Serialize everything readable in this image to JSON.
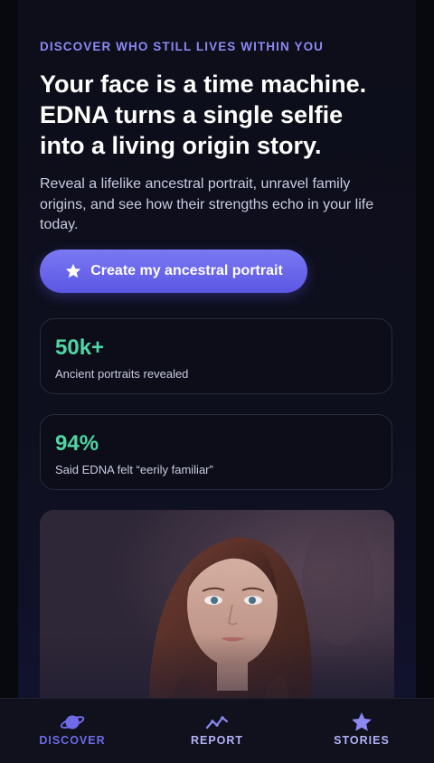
{
  "hero": {
    "eyebrow": "DISCOVER WHO STILL LIVES WITHIN YOU",
    "headline_lines": [
      "Your face is a time machine.",
      "EDNA turns a single selfie",
      "into a living origin story."
    ],
    "intro": "Reveal a lifelike ancestral portrait, unravel family origins, and see how their strengths echo in your life today.",
    "cta": {
      "icon": "star-icon",
      "label": "Create my ancestral portrait"
    }
  },
  "stats": [
    {
      "value": "50k+",
      "label": "Ancient portraits revealed"
    },
    {
      "value": "94%",
      "label": "Said EDNA felt “eerily familiar”"
    }
  ],
  "portrait": {
    "subject": "ancestral-portrait-woman"
  },
  "bottom_nav": {
    "items": [
      {
        "icon": "planet-icon",
        "label": "DISCOVER",
        "active": true
      },
      {
        "icon": "trend-line-icon",
        "label": "REPORT",
        "active": false
      },
      {
        "icon": "star-icon",
        "label": "STORIES",
        "active": false
      }
    ]
  },
  "colors": {
    "background": "#08090f",
    "accent": "#6e6ae8",
    "accent_light": "#8b88f2",
    "stat_value": "#4fd6a4",
    "headline": "#ffffff",
    "body_text": "#c9cbe2"
  }
}
